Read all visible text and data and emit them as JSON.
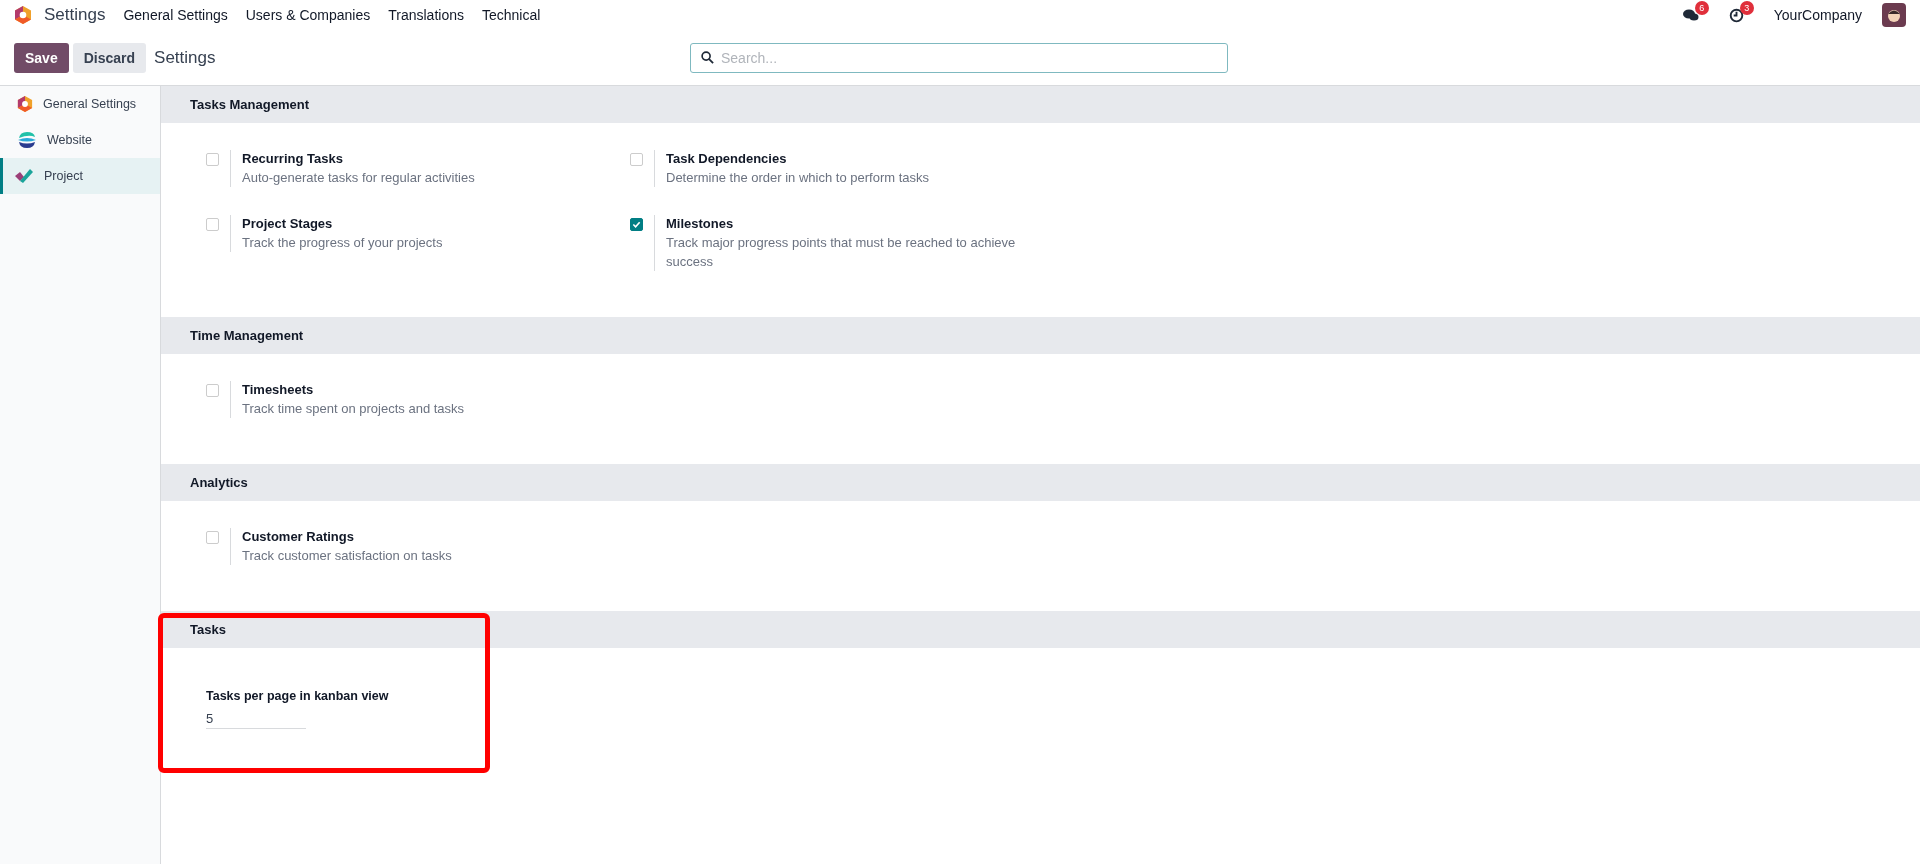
{
  "navbar": {
    "app_title": "Settings",
    "menu": [
      "General Settings",
      "Users & Companies",
      "Translations",
      "Technical"
    ],
    "messages_count": "6",
    "activities_count": "3",
    "company": "YourCompany"
  },
  "control_panel": {
    "save": "Save",
    "discard": "Discard",
    "breadcrumb": "Settings",
    "search": {
      "placeholder": "Search..."
    }
  },
  "sidebar": {
    "items": [
      {
        "label": "General Settings",
        "kind": "general",
        "selected": false
      },
      {
        "label": "Website",
        "kind": "website",
        "selected": false
      },
      {
        "label": "Project",
        "kind": "project",
        "selected": true
      }
    ]
  },
  "sections": [
    {
      "title": "Tasks Management",
      "highlighted": false,
      "settings": [
        {
          "kind": "checkbox",
          "title": "Recurring Tasks",
          "description": "Auto-generate tasks for regular activities",
          "checked": false
        },
        {
          "kind": "checkbox",
          "title": "Task Dependencies",
          "description": "Determine the order in which to perform tasks",
          "checked": false
        },
        {
          "kind": "checkbox",
          "title": "Project Stages",
          "description": "Track the progress of your projects",
          "checked": false
        },
        {
          "kind": "checkbox",
          "title": "Milestones",
          "description": "Track major progress points that must be reached to achieve success",
          "checked": true
        }
      ]
    },
    {
      "title": "Time Management",
      "highlighted": false,
      "settings": [
        {
          "kind": "checkbox",
          "title": "Timesheets",
          "description": "Track time spent on projects and tasks",
          "checked": false
        }
      ]
    },
    {
      "title": "Analytics",
      "highlighted": false,
      "settings": [
        {
          "kind": "checkbox",
          "title": "Customer Ratings",
          "description": "Track customer satisfaction on tasks",
          "checked": false
        }
      ]
    },
    {
      "title": "Tasks",
      "highlighted": true,
      "settings": [
        {
          "kind": "number",
          "title": "Tasks per page in kanban view",
          "value": "5"
        }
      ]
    }
  ]
}
